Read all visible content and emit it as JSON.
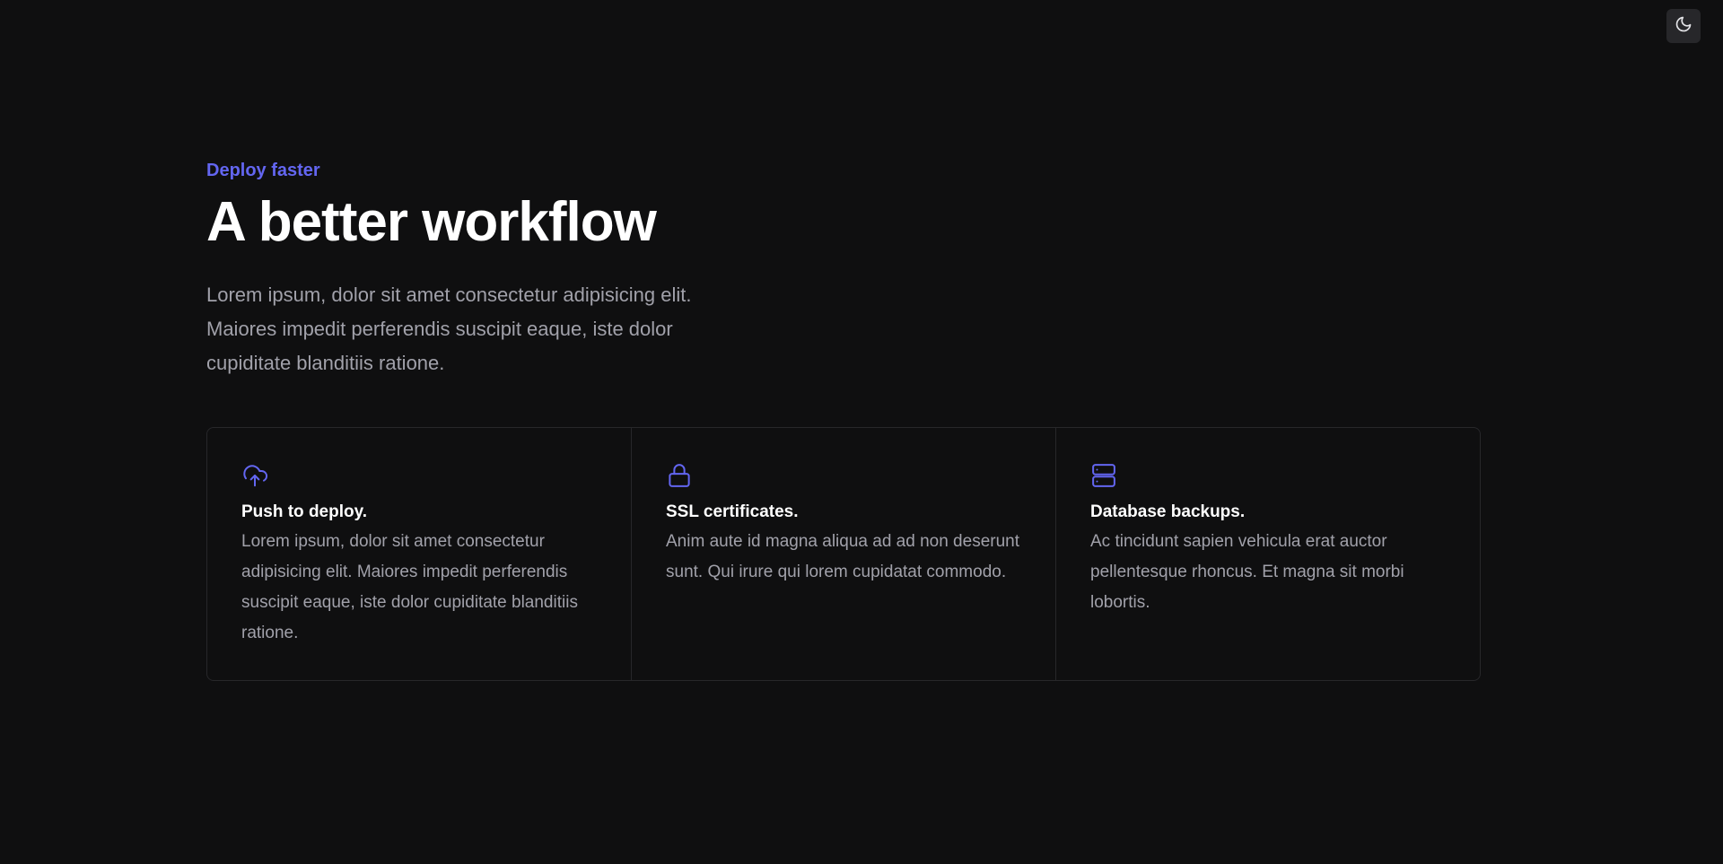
{
  "theme_toggle": {
    "icon": "moon-icon"
  },
  "hero": {
    "eyebrow": "Deploy faster",
    "title": "A better workflow",
    "description": "Lorem ipsum, dolor sit amet consectetur adipisicing elit. Maiores impedit perferendis suscipit eaque, iste dolor cupiditate blanditiis ratione."
  },
  "features": [
    {
      "icon": "cloud-upload-icon",
      "title": "Push to deploy.",
      "description": "Lorem ipsum, dolor sit amet consectetur adipisicing elit. Maiores impedit perferendis suscipit eaque, iste dolor cupiditate blanditiis ratione."
    },
    {
      "icon": "lock-icon",
      "title": "SSL certificates.",
      "description": "Anim aute id magna aliqua ad ad non deserunt sunt. Qui irure qui lorem cupidatat commodo."
    },
    {
      "icon": "server-icon",
      "title": "Database backups.",
      "description": "Ac tincidunt sapien vehicula erat auctor pellentesque rhoncus. Et magna sit morbi lobortis."
    }
  ],
  "colors": {
    "background": "#0f0f10",
    "accent": "#6366f1",
    "heading": "#ffffff",
    "body_text": "#a1a1aa",
    "border": "#27272a"
  }
}
